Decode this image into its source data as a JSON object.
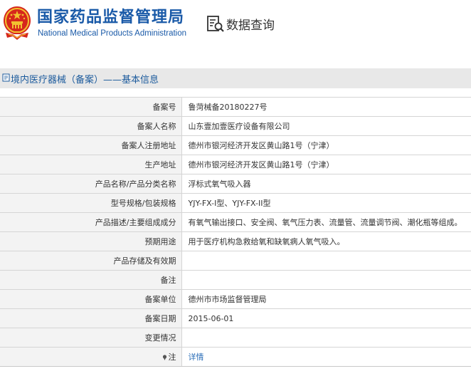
{
  "header": {
    "title": "国家药品监督管理局",
    "subtitle": "National Medical Products Administration",
    "query_label": "数据查询",
    "colors": {
      "brand_blue": "#1a5aa8",
      "emblem_red": "#d6271c",
      "emblem_gold": "#f2c230"
    }
  },
  "breadcrumb": {
    "text": "境内医疗器械（备案）——基本信息"
  },
  "record": {
    "rows": [
      {
        "label": "备案号",
        "value": "鲁菏械备20180227号"
      },
      {
        "label": "备案人名称",
        "value": "山东壹加壹医疗设备有限公司"
      },
      {
        "label": "备案人注册地址",
        "value": "德州市银河经济开发区黄山路1号（宁津）"
      },
      {
        "label": "生产地址",
        "value": "德州市银河经济开发区黄山路1号（宁津）"
      },
      {
        "label": "产品名称/产品分类名称",
        "value": "浮标式氧气吸入器"
      },
      {
        "label": "型号规格/包装规格",
        "value": "YJY-FX-I型、YJY-FX-II型"
      },
      {
        "label": "产品描述/主要组成成分",
        "value": "有氧气输出接口、安全阀、氧气压力表、流量管、流量调节阀、潮化瓶等组成。"
      },
      {
        "label": "预期用途",
        "value": "用于医疗机构急救给氧和缺氧病人氧气吸入。"
      },
      {
        "label": "产品存储及有效期",
        "value": ""
      },
      {
        "label": "备注",
        "value": ""
      },
      {
        "label": "备案单位",
        "value": "德州市市场监督管理局"
      },
      {
        "label": "备案日期",
        "value": "2015-06-01"
      },
      {
        "label": "变更情况",
        "value": ""
      }
    ],
    "note": {
      "label": "注",
      "link": "详情",
      "icon": "pin-icon"
    }
  }
}
